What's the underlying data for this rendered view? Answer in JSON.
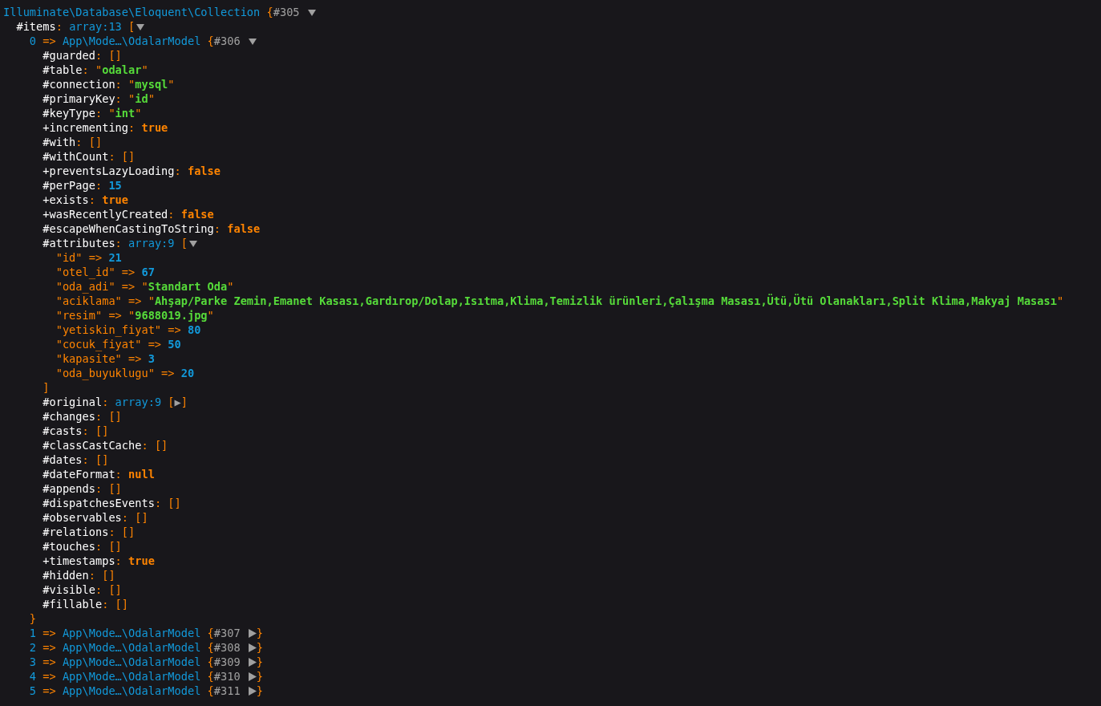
{
  "root": {
    "class": "Illuminate\\Database\\Eloquent\\Collection",
    "brace": "{",
    "ref": "#305",
    "expanded": true
  },
  "items": {
    "key": "#items:",
    "note": "array:13",
    "bracket": "[",
    "expanded": true
  },
  "models": [
    {
      "index": "0",
      "arrow": "=>",
      "class": "App\\Mode…\\OdalarModel",
      "brace": "{",
      "ref": "#306",
      "expanded": true,
      "close": "}"
    },
    {
      "index": "1",
      "arrow": "=>",
      "class": "App\\Mode…\\OdalarModel",
      "brace": "{",
      "ref": "#307",
      "expanded": false,
      "close": "}"
    },
    {
      "index": "2",
      "arrow": "=>",
      "class": "App\\Mode…\\OdalarModel",
      "brace": "{",
      "ref": "#308",
      "expanded": false,
      "close": "}"
    },
    {
      "index": "3",
      "arrow": "=>",
      "class": "App\\Mode…\\OdalarModel",
      "brace": "{",
      "ref": "#309",
      "expanded": false,
      "close": "}"
    },
    {
      "index": "4",
      "arrow": "=>",
      "class": "App\\Mode…\\OdalarModel",
      "brace": "{",
      "ref": "#310",
      "expanded": false,
      "close": "}"
    },
    {
      "index": "5",
      "arrow": "=>",
      "class": "App\\Mode…\\OdalarModel",
      "brace": "{",
      "ref": "#311",
      "expanded": false,
      "close": "}"
    }
  ],
  "properties": [
    {
      "key": "#guarded:",
      "kind": "empty",
      "value": "[]"
    },
    {
      "key": "#table:",
      "kind": "str",
      "value": "\"odalar\""
    },
    {
      "key": "#connection:",
      "kind": "str",
      "value": "\"mysql\""
    },
    {
      "key": "#primaryKey:",
      "kind": "str",
      "value": "\"id\""
    },
    {
      "key": "#keyType:",
      "kind": "str",
      "value": "\"int\""
    },
    {
      "key": "+incrementing:",
      "kind": "const",
      "value": "true"
    },
    {
      "key": "#with:",
      "kind": "empty",
      "value": "[]"
    },
    {
      "key": "#withCount:",
      "kind": "empty",
      "value": "[]"
    },
    {
      "key": "+preventsLazyLoading:",
      "kind": "const",
      "value": "false"
    },
    {
      "key": "#perPage:",
      "kind": "num",
      "value": "15"
    },
    {
      "key": "+exists:",
      "kind": "const",
      "value": "true"
    },
    {
      "key": "+wasRecentlyCreated:",
      "kind": "const",
      "value": "false"
    },
    {
      "key": "#escapeWhenCastingToString:",
      "kind": "const",
      "value": "false"
    },
    {
      "key": "#attributes:",
      "kind": "array",
      "note": "array:9",
      "bracket": "[",
      "expanded": true,
      "close": "]",
      "entries": [
        {
          "key": "\"id\" =>",
          "kind": "num",
          "value": "21"
        },
        {
          "key": "\"otel_id\" =>",
          "kind": "num",
          "value": "67"
        },
        {
          "key": "\"oda_adi\" =>",
          "kind": "str",
          "value": "\"Standart Oda\""
        },
        {
          "key": "\"aciklama\" =>",
          "kind": "str",
          "value": "\"Ahşap/Parke Zemin,Emanet Kasası,Gardırop/Dolap,Isıtma,Klima,Temizlik ürünleri,Çalışma Masası,Ütü,Ütü Olanakları,Split Klima,Makyaj Masası\""
        },
        {
          "key": "\"resim\" =>",
          "kind": "str",
          "value": "\"9688019.jpg\""
        },
        {
          "key": "\"yetiskin_fiyat\" =>",
          "kind": "num",
          "value": "80"
        },
        {
          "key": "\"cocuk_fiyat\" =>",
          "kind": "num",
          "value": "50"
        },
        {
          "key": "\"kapasite\" =>",
          "kind": "num",
          "value": "3"
        },
        {
          "key": "\"oda_buyuklugu\" =>",
          "kind": "num",
          "value": "20"
        }
      ]
    },
    {
      "key": "#original:",
      "kind": "array",
      "note": "array:9",
      "value": "[▶]",
      "expanded": false
    },
    {
      "key": "#changes:",
      "kind": "empty",
      "value": "[]"
    },
    {
      "key": "#casts:",
      "kind": "empty",
      "value": "[]"
    },
    {
      "key": "#classCastCache:",
      "kind": "empty",
      "value": "[]"
    },
    {
      "key": "#dates:",
      "kind": "empty",
      "value": "[]"
    },
    {
      "key": "#dateFormat:",
      "kind": "const",
      "value": "null"
    },
    {
      "key": "#appends:",
      "kind": "empty",
      "value": "[]"
    },
    {
      "key": "#dispatchesEvents:",
      "kind": "empty",
      "value": "[]"
    },
    {
      "key": "#observables:",
      "kind": "empty",
      "value": "[]"
    },
    {
      "key": "#relations:",
      "kind": "empty",
      "value": "[]"
    },
    {
      "key": "#touches:",
      "kind": "empty",
      "value": "[]"
    },
    {
      "key": "+timestamps:",
      "kind": "const",
      "value": "true"
    },
    {
      "key": "#hidden:",
      "kind": "empty",
      "value": "[]"
    },
    {
      "key": "#visible:",
      "kind": "empty",
      "value": "[]"
    },
    {
      "key": "#fillable:",
      "kind": "empty",
      "value": "[]"
    }
  ]
}
